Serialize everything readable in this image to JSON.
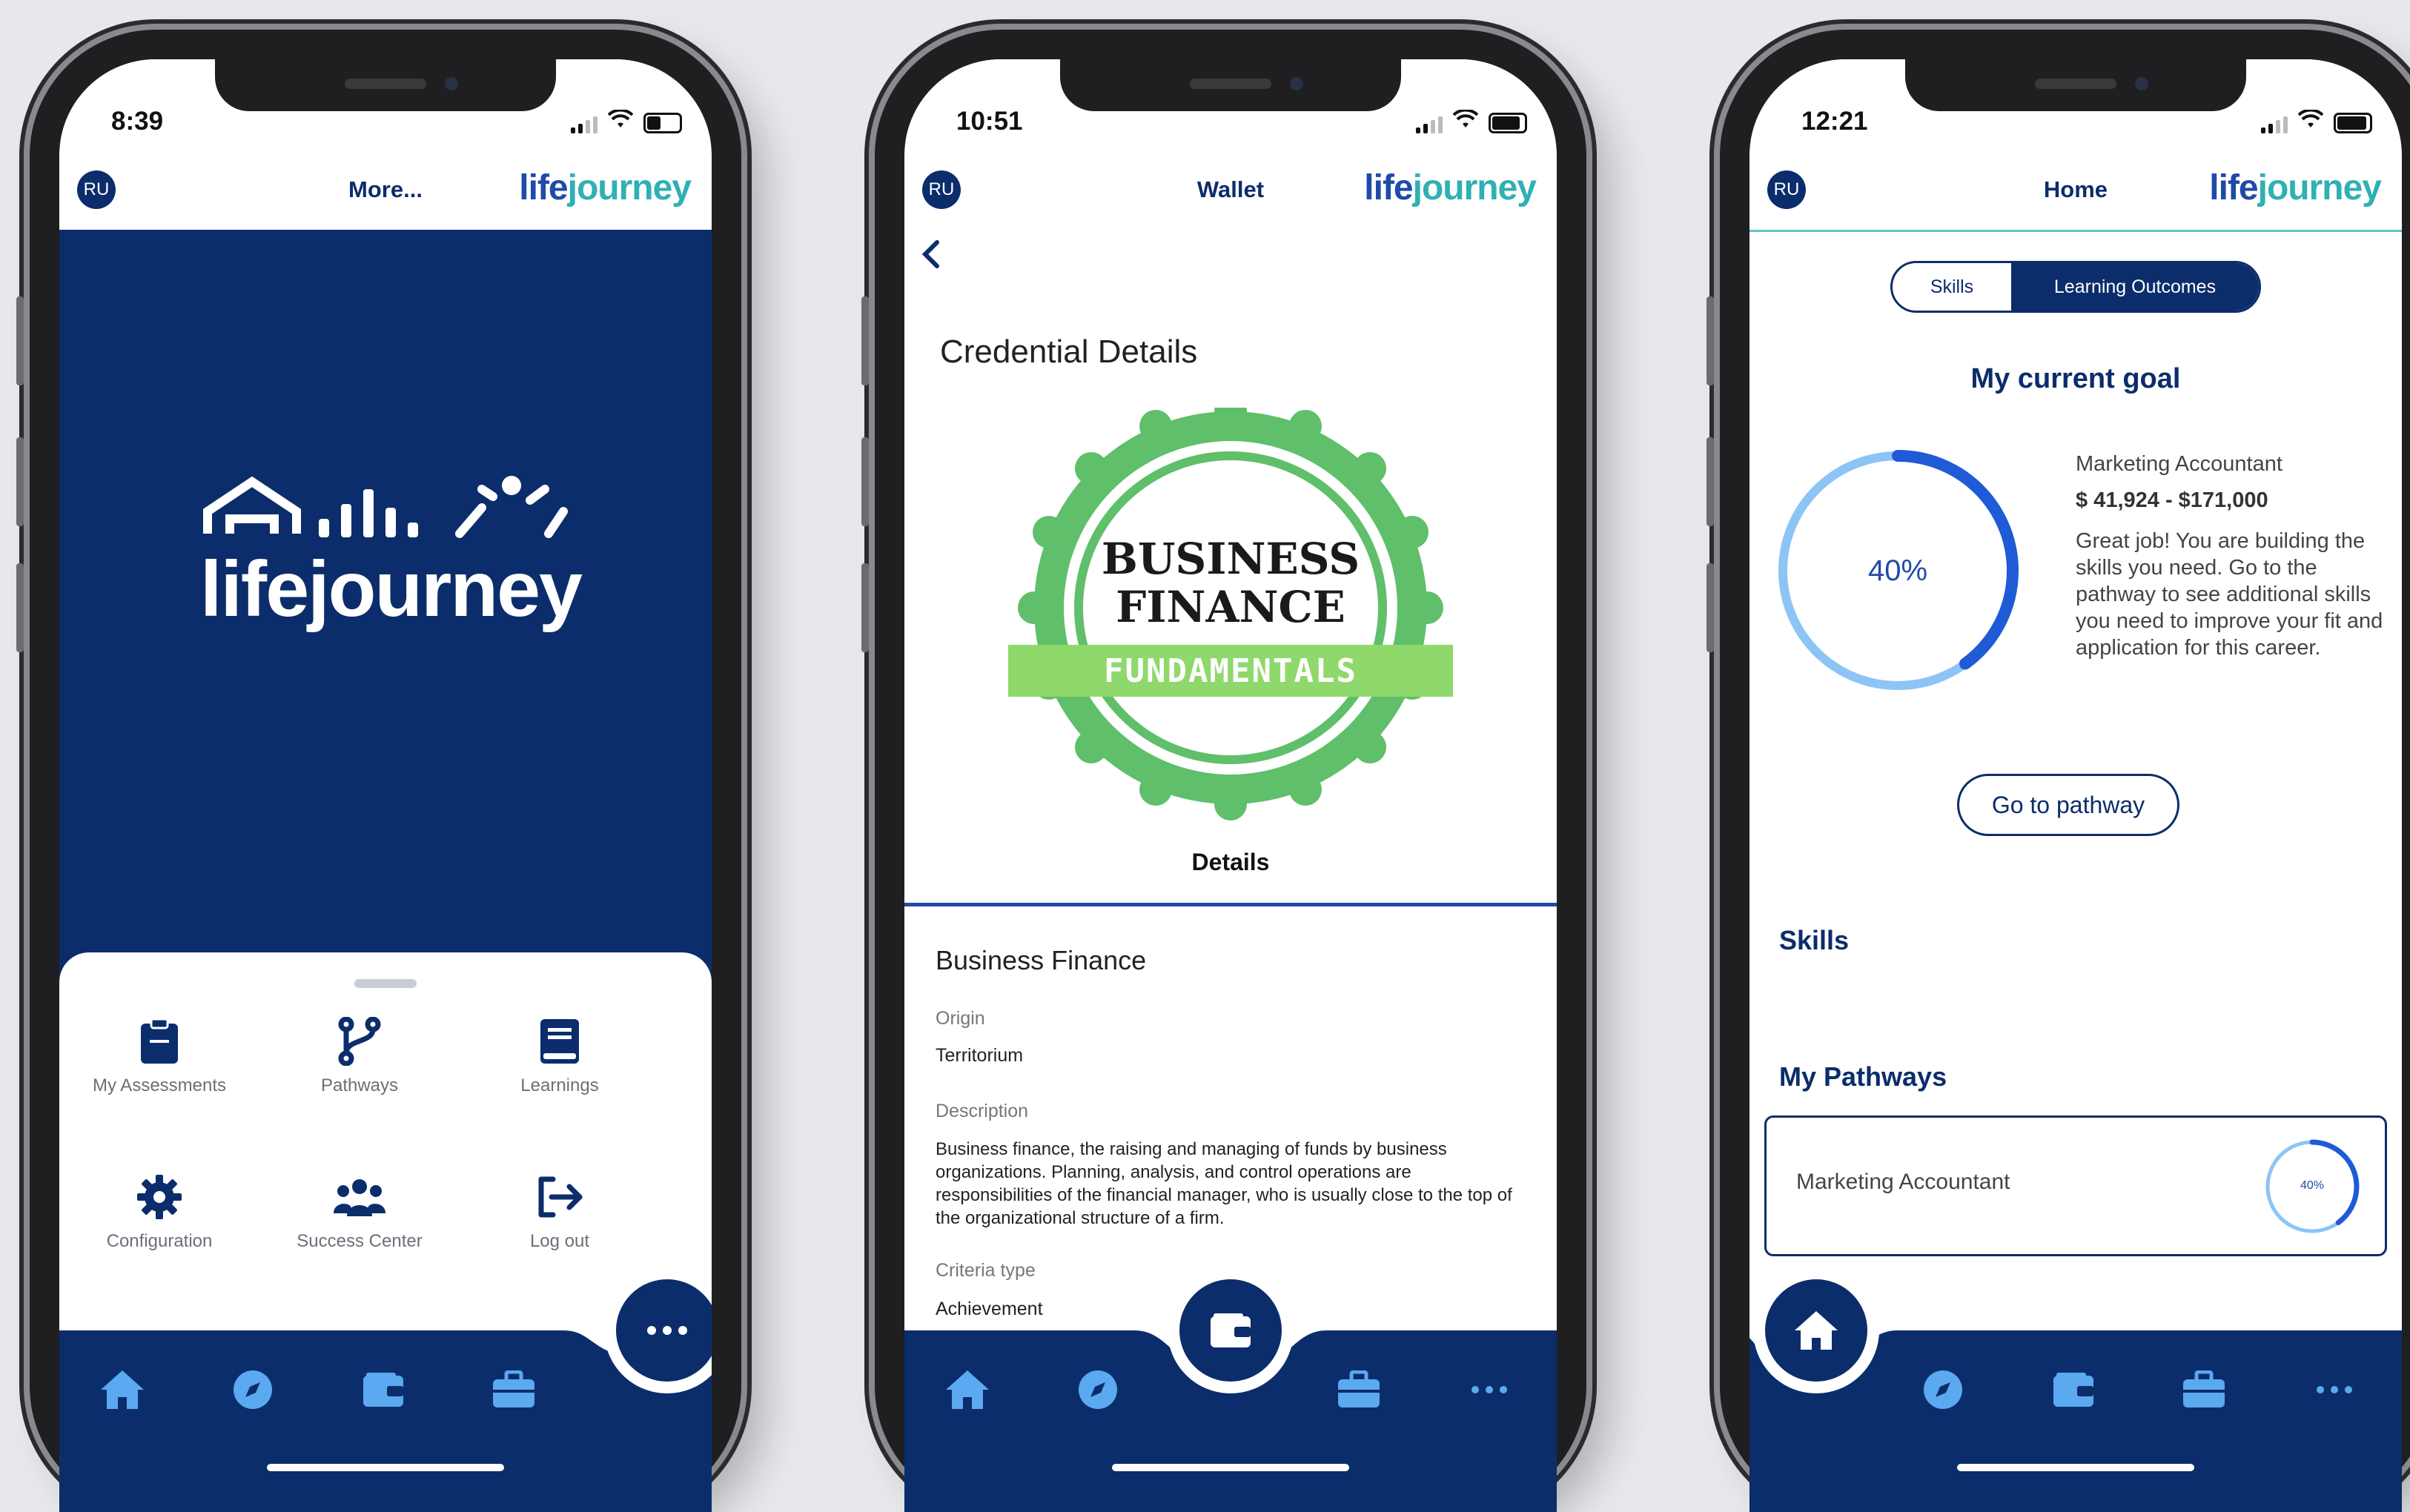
{
  "colors": {
    "navy": "#0c2d6b",
    "accent_blue": "#1f4aa8",
    "teal": "#2fb0b4",
    "icon_light_blue": "#5aa9f1",
    "badge_green": "#5fbf6a",
    "badge_light_green": "#8fd86b"
  },
  "common": {
    "avatar_initials": "RU",
    "brand_part1": "life",
    "brand_part2": "journey",
    "nav_icons": [
      "home-icon",
      "compass-icon",
      "wallet-icon",
      "briefcase-icon",
      "more-icon"
    ]
  },
  "phone1": {
    "time": "8:39",
    "header_title": "More...",
    "splash_logo_text": "lifejourney",
    "menu": [
      {
        "label": "My Assessments",
        "icon": "clipboard-icon"
      },
      {
        "label": "Pathways",
        "icon": "branch-icon"
      },
      {
        "label": "Learnings",
        "icon": "book-icon"
      },
      {
        "label": "Configuration",
        "icon": "gear-icon"
      },
      {
        "label": "Success Center",
        "icon": "group-icon"
      },
      {
        "label": "Log out",
        "icon": "logout-icon"
      }
    ],
    "active_nav": "more"
  },
  "phone2": {
    "time": "10:51",
    "header_title": "Wallet",
    "page_title": "Credential Details",
    "badge": {
      "line1": "BUSINESS",
      "line2": "FINANCE",
      "ribbon": "FUNDAMENTALS"
    },
    "tab": "Details",
    "credential_name": "Business Finance",
    "origin_label": "Origin",
    "origin_value": "Territorium",
    "description_label": "Description",
    "description_value": "Business finance, the raising and managing of funds by business organizations. Planning, analysis, and control operations are responsibilities of the financial manager, who is usually close to the top of the organizational structure of a firm.",
    "criteria_label": "Criteria type",
    "criteria_value": "Achievement",
    "active_nav": "wallet"
  },
  "phone3": {
    "time": "12:21",
    "header_title": "Home",
    "toggle": {
      "option1": "Skills",
      "option2": "Learning Outcomes",
      "selected": "Learning Outcomes"
    },
    "goal_title": "My current goal",
    "goal_progress": 0.4,
    "goal_progress_label": "40%",
    "goal_role": "Marketing Accountant",
    "goal_salary": "$ 41,924 - $171,000",
    "goal_message": "Great job! You are building the skills you need. Go to the pathway to see additional skills you need to improve your fit and application for this career.",
    "go_button": "Go to pathway",
    "skills_heading": "Skills",
    "pathways_heading": "My Pathways",
    "pathway": {
      "name": "Marketing Accountant",
      "progress": 0.4,
      "progress_label": "40%"
    },
    "active_nav": "home"
  }
}
